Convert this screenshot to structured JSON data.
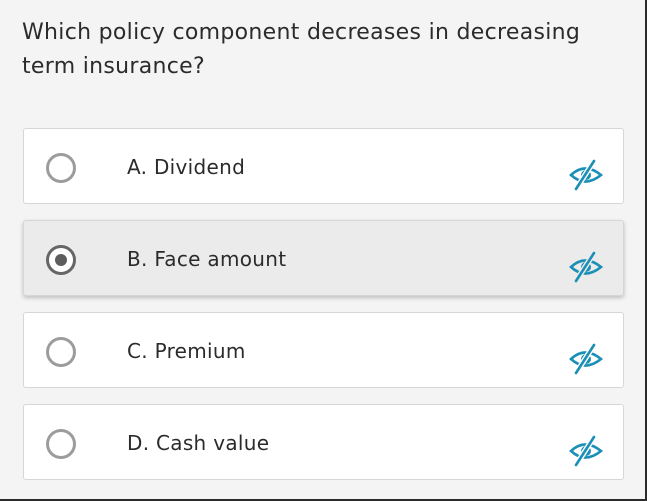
{
  "question": {
    "text": "Which policy component decreases in decreasing term insurance?"
  },
  "options": [
    {
      "label": "A. Dividend",
      "selected": false,
      "hide_icon": "eye-slash-icon"
    },
    {
      "label": "B. Face amount",
      "selected": true,
      "hide_icon": "eye-slash-icon"
    },
    {
      "label": "C. Premium",
      "selected": false,
      "hide_icon": "eye-slash-icon"
    },
    {
      "label": "D. Cash value",
      "selected": false,
      "hide_icon": "eye-slash-icon"
    }
  ],
  "colors": {
    "background": "#f4f4f4",
    "card": "#ffffff",
    "card_selected": "#ebebeb",
    "accent_icon": "#1b8fb6",
    "text": "#2b2b2b"
  }
}
